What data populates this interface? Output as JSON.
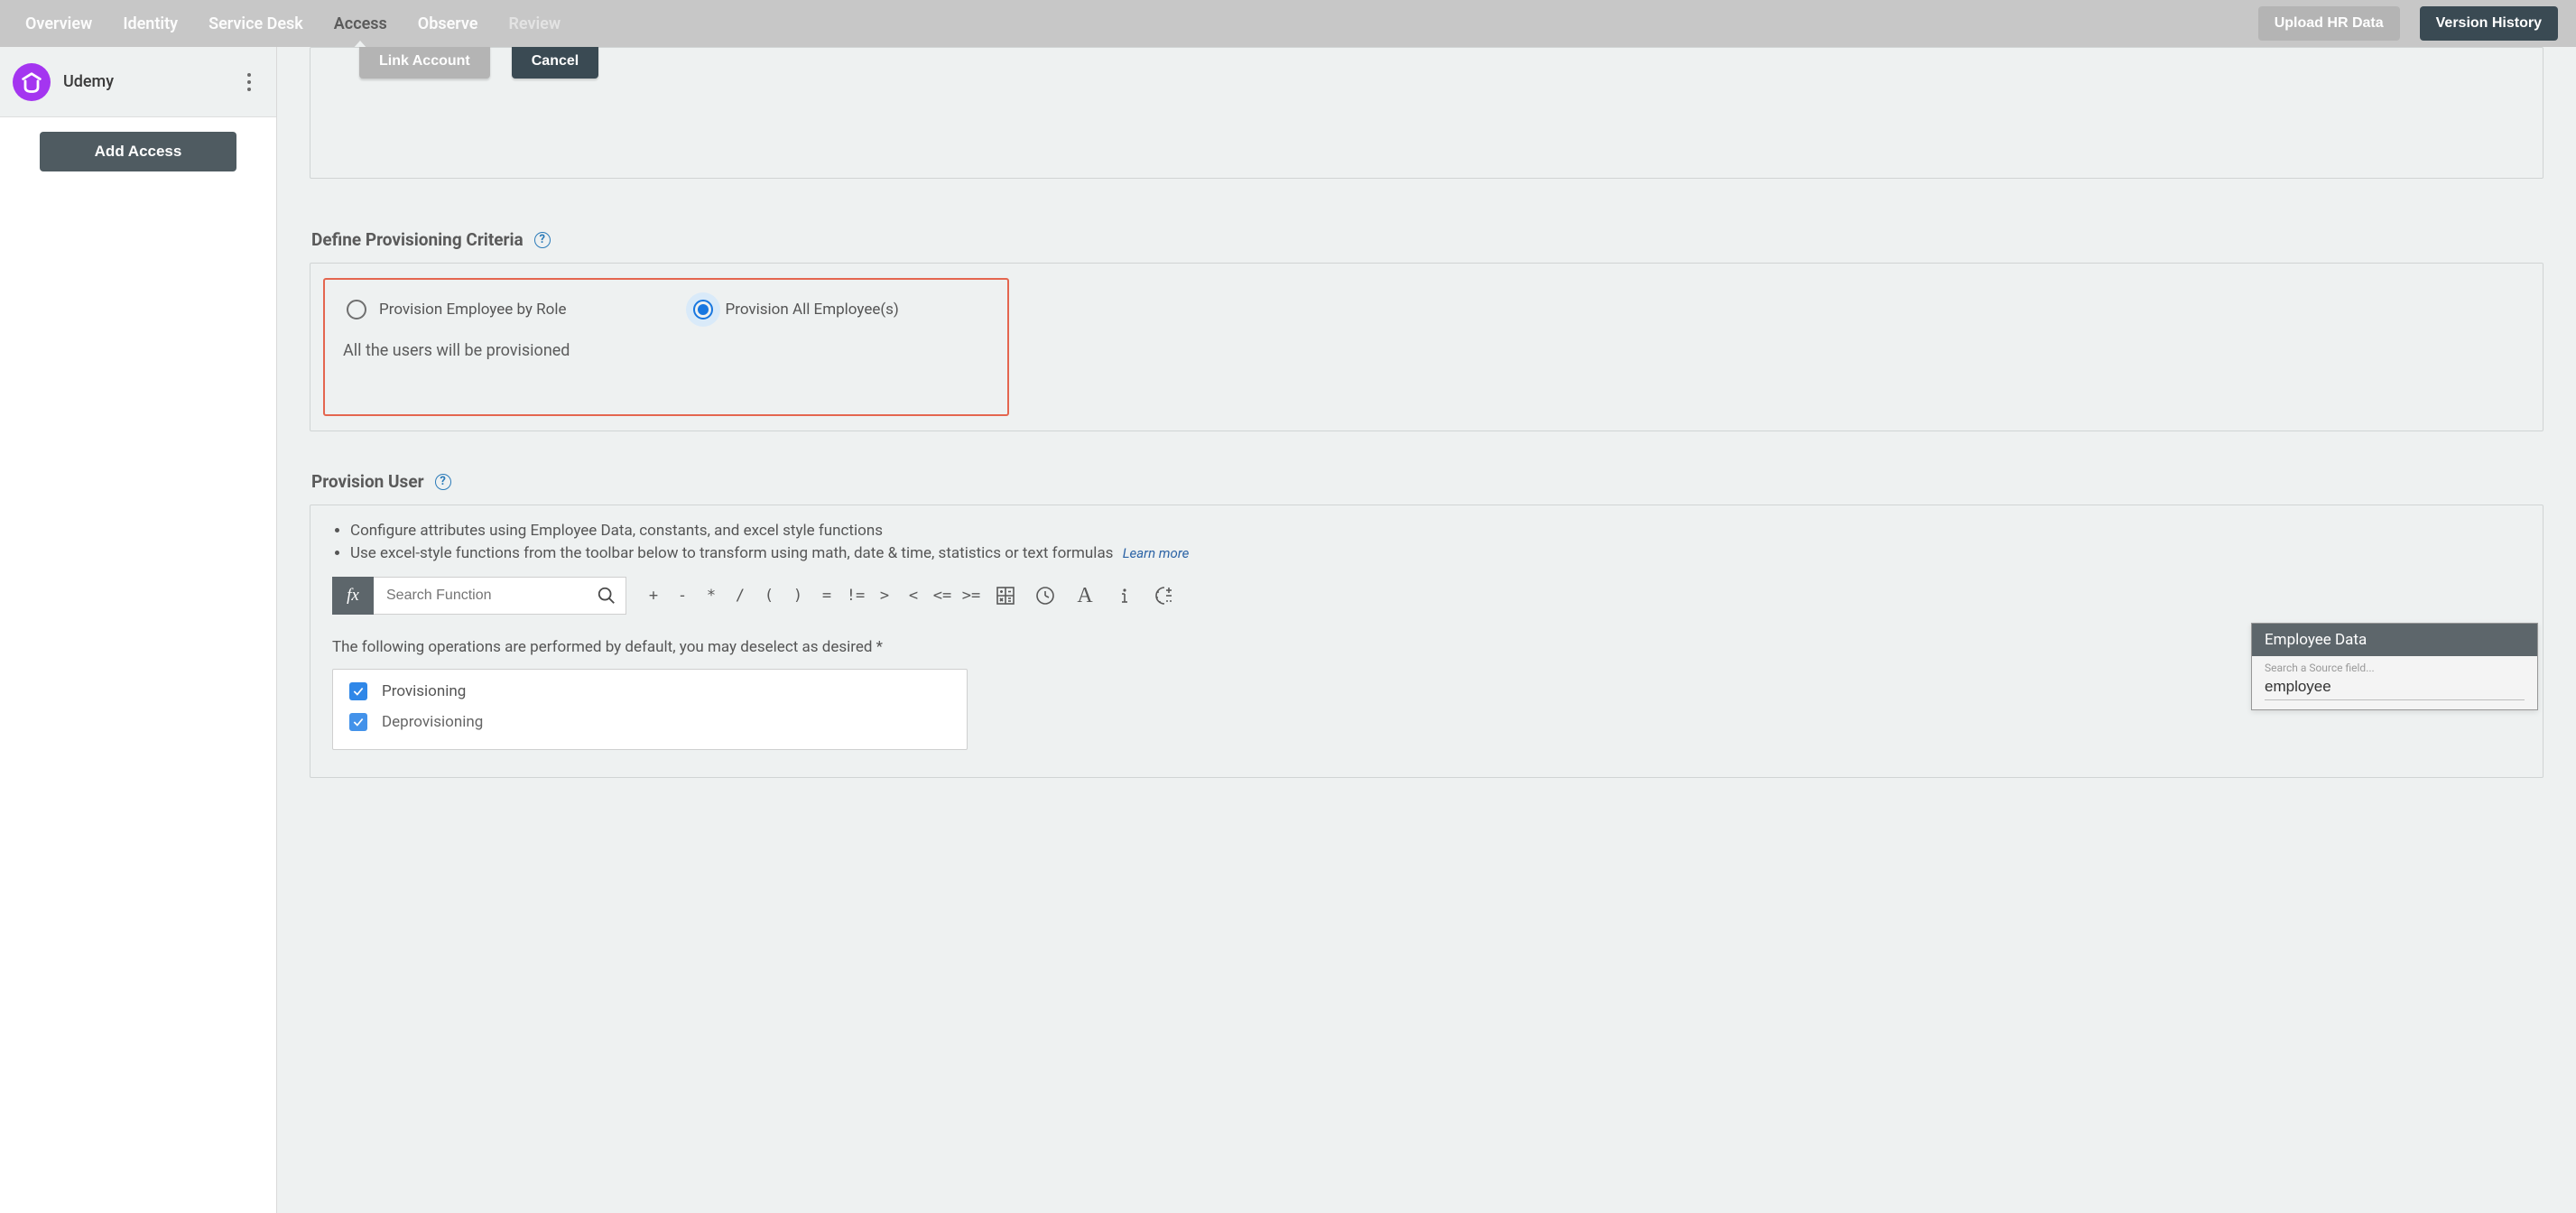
{
  "topbar": {
    "tabs": {
      "overview": "Overview",
      "identity": "Identity",
      "service_desk": "Service Desk",
      "access": "Access",
      "observe": "Observe",
      "review": "Review"
    },
    "upload_btn": "Upload HR Data",
    "history_btn": "Version History"
  },
  "sidebar": {
    "app_name": "Udemy",
    "add_access_btn": "Add Access"
  },
  "link_account": {
    "link_btn": "Link Account",
    "cancel_btn": "Cancel"
  },
  "criteria": {
    "heading": "Define Provisioning Criteria",
    "radio_by_role": "Provision Employee by Role",
    "radio_all": "Provision All Employee(s)",
    "message": "All the users will be provisioned"
  },
  "provision": {
    "heading": "Provision User",
    "bullet1": "Configure attributes using Employee Data, constants, and excel style functions",
    "bullet2": "Use excel-style functions from the toolbar below to transform using math, date & time, statistics or text formulas",
    "learn_more": "Learn more",
    "fx_badge": "fx",
    "search_placeholder": "Search Function",
    "operators": {
      "plus": "+",
      "minus": "-",
      "mul": "*",
      "div": "/",
      "lparen": "(",
      "rparen": ")",
      "eq": "=",
      "neq": "!=",
      "gt": ">",
      "lt": "<",
      "lte": "<=",
      "gte": ">="
    },
    "ops_note": "The following operations are performed by default, you may deselect as desired *",
    "op_provisioning": "Provisioning",
    "op_deprovisioning": "Deprovisioning"
  },
  "employee_panel": {
    "title": "Employee Data",
    "placeholder": "Search a Source field...",
    "value": "employee"
  }
}
